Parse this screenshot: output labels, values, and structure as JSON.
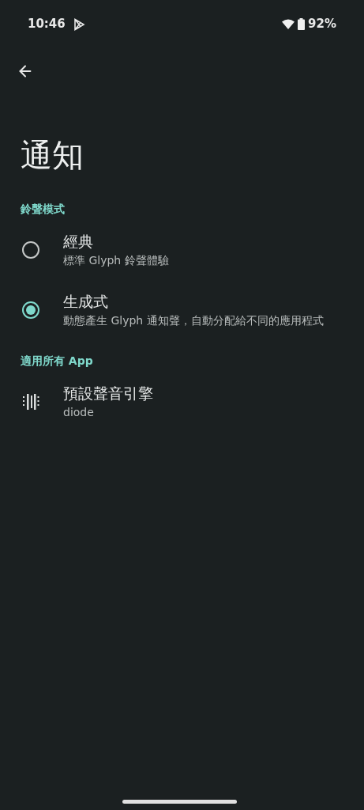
{
  "status_bar": {
    "time": "10:46",
    "battery": "92%"
  },
  "title": "通知",
  "sections": [
    {
      "header": "鈴聲模式",
      "items": [
        {
          "kind": "radio",
          "title": "經典",
          "subtitle": "標準 Glyph 鈴聲體驗",
          "selected": false
        },
        {
          "kind": "radio",
          "title": "生成式",
          "subtitle": "動態產生 Glyph 通知聲，自動分配給不同的應用程式",
          "selected": true
        }
      ]
    },
    {
      "header": "適用所有 App",
      "items": [
        {
          "kind": "icon",
          "title": "預設聲音引擎",
          "subtitle": "diode"
        }
      ]
    }
  ]
}
